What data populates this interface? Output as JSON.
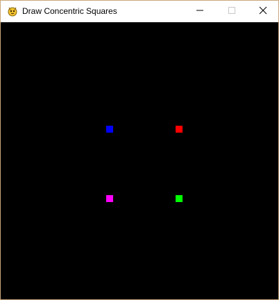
{
  "window": {
    "title": "Draw Concentric Squares",
    "app_icon": "pygame-snake-icon"
  },
  "controls": {
    "minimize_icon": "minimize-icon",
    "maximize_icon": "maximize-icon",
    "close_icon": "close-icon"
  },
  "canvas": {
    "background": "#000000",
    "squares": [
      {
        "name": "blue",
        "color": "#0000ff"
      },
      {
        "name": "red",
        "color": "#ff0000"
      },
      {
        "name": "magenta",
        "color": "#ff00ff"
      },
      {
        "name": "green",
        "color": "#00ff00"
      }
    ]
  }
}
